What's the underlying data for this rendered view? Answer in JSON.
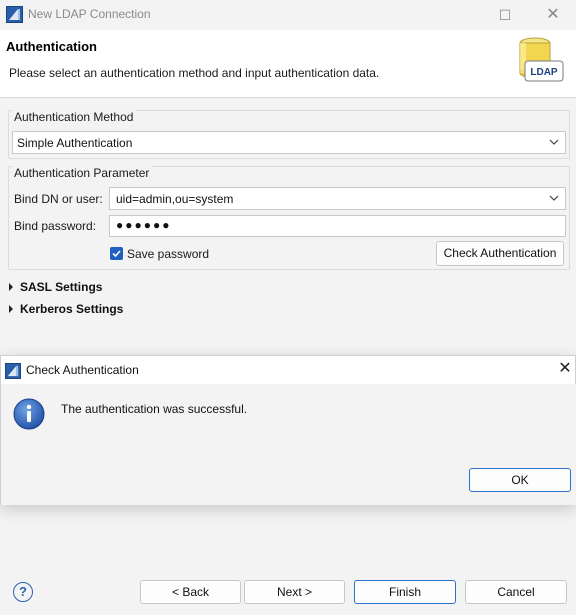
{
  "window": {
    "title": "New LDAP Connection",
    "maximize_glyph": "☐",
    "close_glyph": "✕"
  },
  "banner": {
    "heading": "Authentication",
    "description": "Please select an authentication method and input authentication data.",
    "logo_text": "LDAP"
  },
  "auth_method": {
    "group_label": "Authentication Method",
    "selected": "Simple Authentication"
  },
  "auth_params": {
    "group_label": "Authentication Parameter",
    "bind_dn_label": "Bind DN or user:",
    "bind_dn_value": "uid=admin,ou=system",
    "bind_password_label": "Bind password:",
    "bind_password_value": "●●●●●●",
    "save_password_label": "Save password",
    "save_password_checked": true,
    "check_button_label": "Check Authentication"
  },
  "sections": {
    "sasl": "SASL Settings",
    "kerberos": "Kerberos Settings"
  },
  "dialog": {
    "title": "Check Authentication",
    "close_glyph": "✕",
    "message": "The authentication was successful.",
    "ok_label": "OK"
  },
  "footer": {
    "help_glyph": "?",
    "back_label": "< Back",
    "next_label": "Next >",
    "finish_label": "Finish",
    "cancel_label": "Cancel"
  },
  "colors": {
    "accent": "#1f5fbf",
    "primary_border": "#2b6fd1",
    "info_blue": "#2a5db8"
  }
}
